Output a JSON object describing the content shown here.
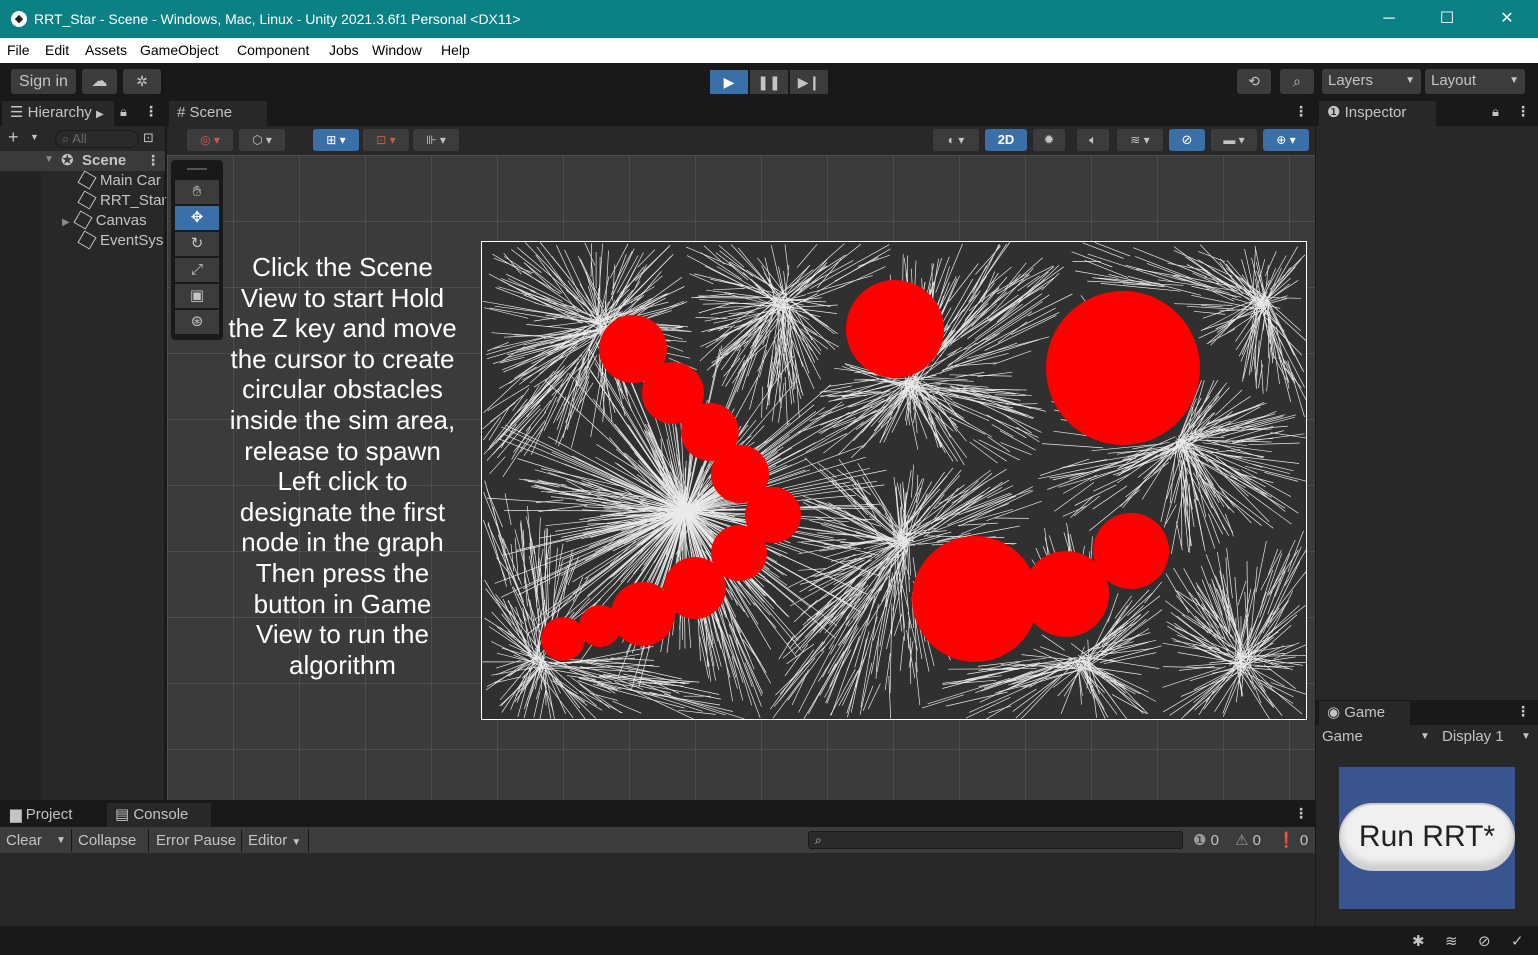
{
  "window": {
    "title": "RRT_Star - Scene - Windows, Mac, Linux - Unity 2021.3.6f1 Personal <DX11>",
    "controls": [
      "─",
      "☐",
      "✕"
    ]
  },
  "menu": [
    "File",
    "Edit",
    "Assets",
    "GameObject",
    "Component",
    "Jobs",
    "Window",
    "Help"
  ],
  "toolbar": {
    "sign_in": "Sign in",
    "layers": "Layers",
    "layout": "Layout"
  },
  "hierarchy": {
    "tab": "Hierarchy",
    "search_placeholder": "All",
    "scene": "Scene",
    "items": [
      "Main Car",
      "RRT_Star",
      "Canvas",
      "EventSys"
    ]
  },
  "scene": {
    "tab": "Scene",
    "mode_2d": "2D",
    "instructions": "Click the Scene View to start Hold the Z key and move the cursor to create circular obstacles inside the sim area, release to spawn Left click to designate the first node in the graph Then press the button in Game View to run the algorithm",
    "obstacle_color": "#ff0000",
    "tree_color": "#ffffff"
  },
  "inspector": {
    "tab": "Inspector"
  },
  "game": {
    "tab": "Game",
    "view_dropdown": "Game",
    "display_dropdown": "Display 1",
    "run_button": "Run RRT*",
    "bg_color": "#3a5490"
  },
  "console": {
    "tabs": [
      "Project",
      "Console"
    ],
    "clear": "Clear",
    "collapse": "Collapse",
    "error_pause": "Error Pause",
    "editor": "Editor",
    "counts": {
      "log": "0",
      "warnings": "0",
      "errors": "0"
    }
  }
}
